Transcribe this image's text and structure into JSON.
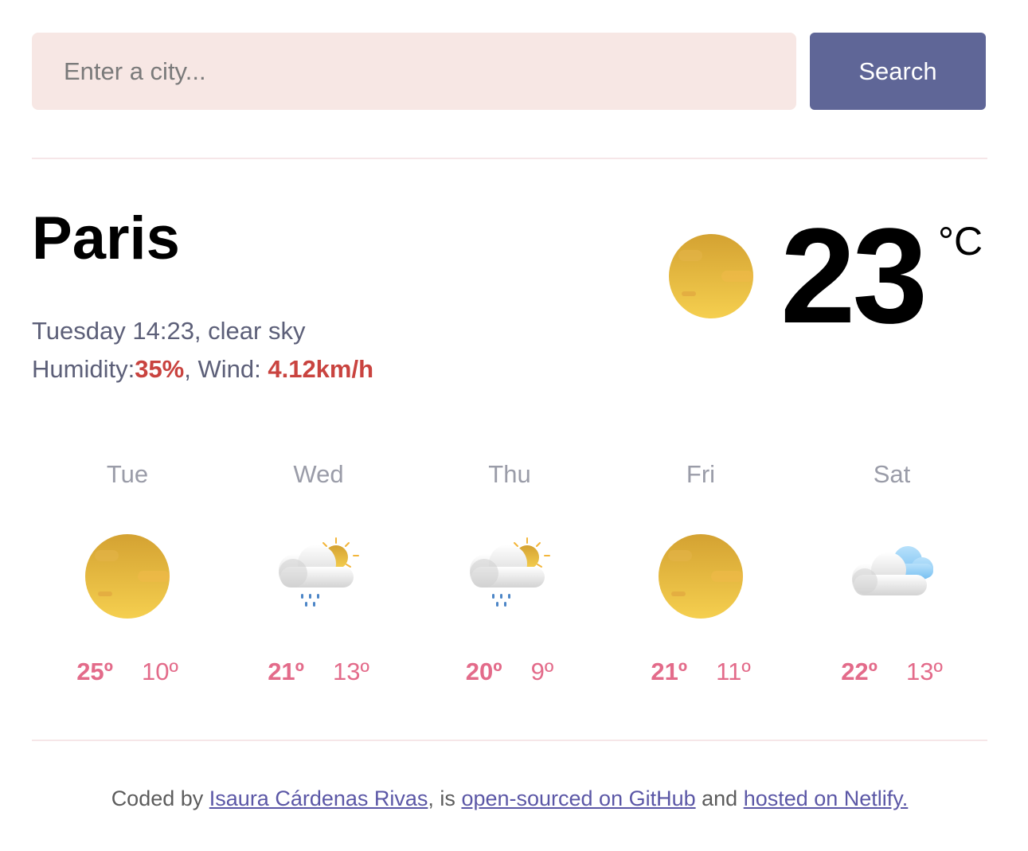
{
  "search": {
    "placeholder": "Enter a city...",
    "button_label": "Search"
  },
  "current": {
    "city": "Paris",
    "datetime_description": "Tuesday 14:23, clear sky",
    "humidity_label": "Humidity:",
    "humidity_value": "35%",
    "wind_label": ", Wind: ",
    "wind_value": "4.12km/h",
    "temperature": "23",
    "unit": "°C",
    "icon": "clear-sky-icon"
  },
  "forecast": [
    {
      "day": "Tue",
      "icon": "sun-icon",
      "max": "25º",
      "min": "10º"
    },
    {
      "day": "Wed",
      "icon": "rain-cloud-sun-icon",
      "max": "21º",
      "min": "13º"
    },
    {
      "day": "Thu",
      "icon": "rain-cloud-sun-icon",
      "max": "20º",
      "min": "9º"
    },
    {
      "day": "Fri",
      "icon": "sun-icon",
      "max": "21º",
      "min": "11º"
    },
    {
      "day": "Sat",
      "icon": "cloud-icon",
      "max": "22º",
      "min": "13º"
    }
  ],
  "footer": {
    "prefix": "Coded by ",
    "author_link": "Isaura Cárdenas Rivas",
    "mid1": ", is ",
    "github_link": "open-sourced on GitHub",
    "mid2": " and ",
    "netlify_link": "hosted on Netlify."
  },
  "colors": {
    "accent_button": "#5f6697",
    "input_bg": "#f7e7e4",
    "highlight": "#c9433f",
    "forecast_temp": "#e36b8a",
    "link": "#5b57a6"
  }
}
